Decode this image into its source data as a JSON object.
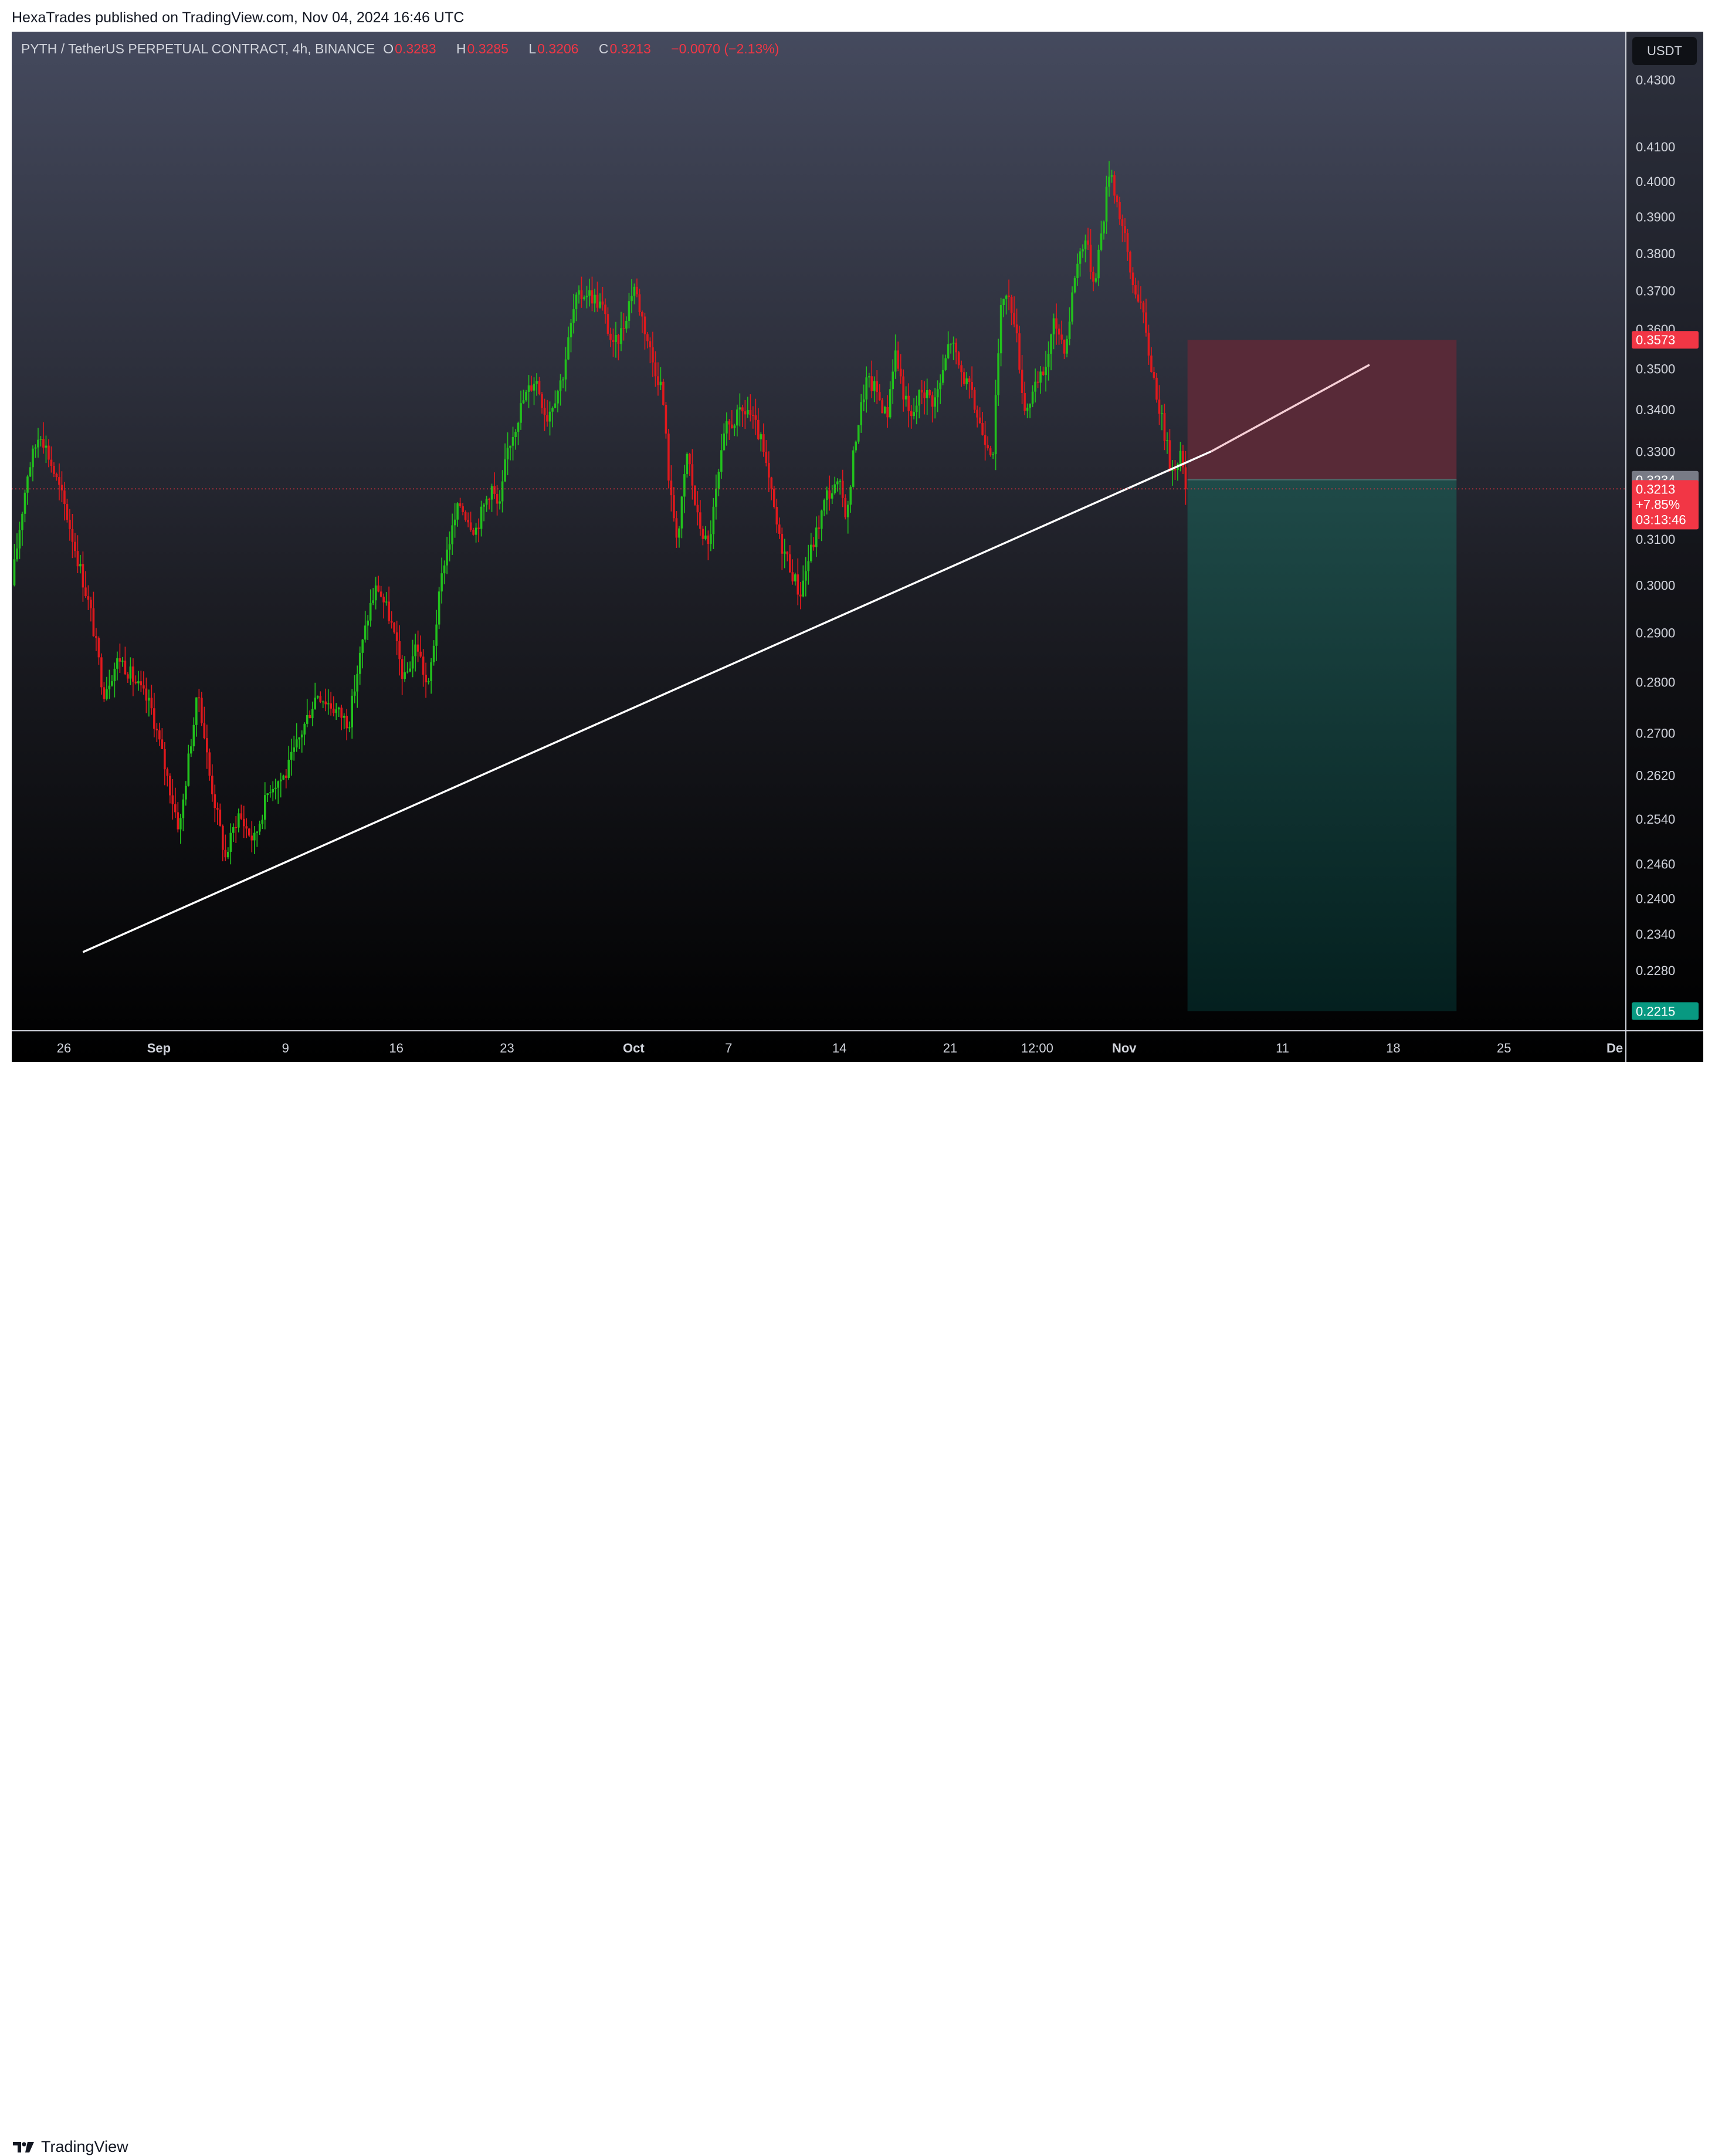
{
  "header": {
    "published_text": "HexaTrades published on TradingView.com, Nov 04, 2024 16:46 UTC"
  },
  "legend": {
    "symbol": "PYTH / TetherUS PERPETUAL CONTRACT, 4h, BINANCE",
    "open_label": "O",
    "open": "0.3283",
    "high_label": "H",
    "high": "0.3285",
    "low_label": "L",
    "low": "0.3206",
    "close_label": "C",
    "close": "0.3213",
    "change": "−0.0070 (−2.13%)"
  },
  "currency_button": "USDT",
  "footer": {
    "brand": "TradingView"
  },
  "colors": {
    "up": "#22c11d",
    "down": "#e0191d",
    "trendline": "#ffffff",
    "stop_zone": "#5b2a38",
    "target_zone": "#103a37",
    "stop_label": "#f23645",
    "target_label": "#089981",
    "last_price": "#f23645"
  },
  "chart_data": {
    "type": "candlestick",
    "symbol": "PYTH/USDT",
    "timeframe": "4h",
    "y_axis": {
      "ticks": [
        "0.4300",
        "0.4100",
        "0.4000",
        "0.3900",
        "0.3800",
        "0.3700",
        "0.3600",
        "0.3500",
        "0.3400",
        "0.3300",
        "0.3100",
        "0.3000",
        "0.2900",
        "0.2800",
        "0.2700",
        "0.2620",
        "0.2540",
        "0.2460",
        "0.2400",
        "0.2340",
        "0.2280"
      ],
      "scale": "log",
      "range": [
        0.2185,
        0.445
      ]
    },
    "x_axis": {
      "ticks": [
        "26",
        "Sep",
        "9",
        "16",
        "23",
        "Oct",
        "7",
        "14",
        "21",
        "12:00",
        "Nov",
        "11",
        "18",
        "25",
        "De"
      ],
      "tick_days": [
        26,
        32,
        40,
        47,
        54,
        62,
        68,
        75,
        82,
        87.5,
        93,
        103,
        110,
        117,
        124
      ],
      "range_days": [
        22.7,
        124.7
      ]
    },
    "price_path": [
      [
        22.7,
        0.3
      ],
      [
        23.7,
        0.325
      ],
      [
        24.5,
        0.335
      ],
      [
        26,
        0.318
      ],
      [
        27.7,
        0.294
      ],
      [
        28.5,
        0.278
      ],
      [
        29.5,
        0.285
      ],
      [
        30.5,
        0.28
      ],
      [
        31.5,
        0.275
      ],
      [
        32.5,
        0.262
      ],
      [
        33.3,
        0.252
      ],
      [
        34,
        0.268
      ],
      [
        34.5,
        0.278
      ],
      [
        35.2,
        0.262
      ],
      [
        36.2,
        0.247
      ],
      [
        37,
        0.255
      ],
      [
        38,
        0.25
      ],
      [
        39,
        0.26
      ],
      [
        40,
        0.262
      ],
      [
        41,
        0.27
      ],
      [
        42,
        0.278
      ],
      [
        43,
        0.275
      ],
      [
        44,
        0.272
      ],
      [
        44.7,
        0.285
      ],
      [
        45.3,
        0.295
      ],
      [
        45.8,
        0.3
      ],
      [
        46.6,
        0.293
      ],
      [
        47.5,
        0.28
      ],
      [
        48.3,
        0.288
      ],
      [
        49,
        0.278
      ],
      [
        50,
        0.305
      ],
      [
        51,
        0.318
      ],
      [
        52,
        0.312
      ],
      [
        53,
        0.322
      ],
      [
        53.5,
        0.316
      ],
      [
        54,
        0.33
      ],
      [
        55,
        0.342
      ],
      [
        55.8,
        0.348
      ],
      [
        56.5,
        0.338
      ],
      [
        57.5,
        0.348
      ],
      [
        58.3,
        0.367
      ],
      [
        59,
        0.37
      ],
      [
        60,
        0.366
      ],
      [
        60.7,
        0.355
      ],
      [
        61.3,
        0.36
      ],
      [
        62,
        0.372
      ],
      [
        62.6,
        0.362
      ],
      [
        63.2,
        0.352
      ],
      [
        63.8,
        0.345
      ],
      [
        64.3,
        0.32
      ],
      [
        64.8,
        0.31
      ],
      [
        65.4,
        0.33
      ],
      [
        66,
        0.315
      ],
      [
        66.7,
        0.308
      ],
      [
        67.2,
        0.32
      ],
      [
        67.8,
        0.335
      ],
      [
        68.5,
        0.338
      ],
      [
        69.2,
        0.34
      ],
      [
        70,
        0.333
      ],
      [
        70.7,
        0.32
      ],
      [
        71.2,
        0.31
      ],
      [
        71.8,
        0.305
      ],
      [
        72.5,
        0.298
      ],
      [
        73,
        0.305
      ],
      [
        73.6,
        0.312
      ],
      [
        74.2,
        0.32
      ],
      [
        75,
        0.322
      ],
      [
        75.5,
        0.315
      ],
      [
        76,
        0.333
      ],
      [
        76.7,
        0.347
      ],
      [
        77.3,
        0.345
      ],
      [
        78,
        0.338
      ],
      [
        78.5,
        0.355
      ],
      [
        79,
        0.345
      ],
      [
        79.5,
        0.337
      ],
      [
        80.2,
        0.345
      ],
      [
        81,
        0.342
      ],
      [
        81.5,
        0.348
      ],
      [
        82,
        0.358
      ],
      [
        82.6,
        0.35
      ],
      [
        83.2,
        0.345
      ],
      [
        84,
        0.335
      ],
      [
        84.7,
        0.33
      ],
      [
        85.3,
        0.37
      ],
      [
        86,
        0.365
      ],
      [
        86.7,
        0.34
      ],
      [
        87.4,
        0.345
      ],
      [
        88,
        0.35
      ],
      [
        88.6,
        0.362
      ],
      [
        89.3,
        0.355
      ],
      [
        89.9,
        0.375
      ],
      [
        90.5,
        0.385
      ],
      [
        91.1,
        0.372
      ],
      [
        91.7,
        0.39
      ],
      [
        92.1,
        0.405
      ],
      [
        92.5,
        0.395
      ],
      [
        93,
        0.385
      ],
      [
        93.5,
        0.372
      ],
      [
        94,
        0.368
      ],
      [
        94.5,
        0.355
      ],
      [
        95,
        0.345
      ],
      [
        95.5,
        0.335
      ],
      [
        96,
        0.325
      ],
      [
        96.5,
        0.33
      ],
      [
        96.9,
        0.3213
      ]
    ],
    "candle_spacing_days": 0.1667,
    "last_price": {
      "value": 0.3213,
      "label": "0.3213",
      "change": "+7.85%",
      "countdown": "03:13:46"
    },
    "markers": [
      {
        "label": "0.3573",
        "value": 0.3573,
        "kind": "stop"
      },
      {
        "label": "0.3234",
        "value": 0.3234,
        "kind": "entry"
      },
      {
        "label": "0.2215",
        "value": 0.2215,
        "kind": "target"
      }
    ],
    "position": {
      "type": "short",
      "entry": 0.3234,
      "stop": 0.3573,
      "target": 0.2215,
      "from_day": 97,
      "to_day": 114
    },
    "trendline": {
      "points": [
        [
          27.2,
          0.231
        ],
        [
          98.5,
          0.33
        ]
      ],
      "extension_to": [
        108.5,
        0.351
      ]
    }
  }
}
